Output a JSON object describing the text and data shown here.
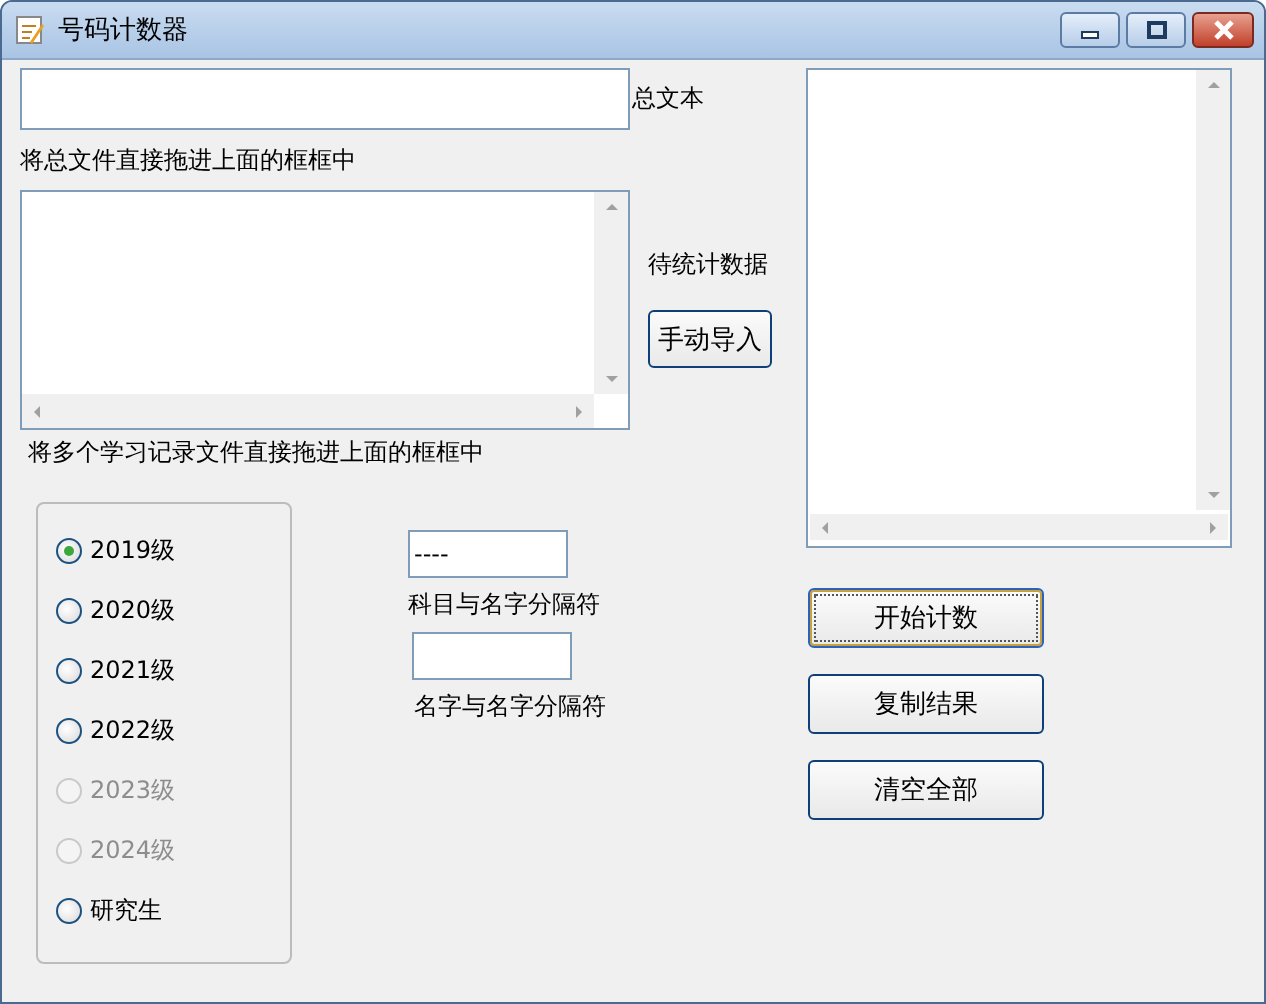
{
  "window": {
    "title": "号码计数器"
  },
  "total_text": {
    "label": "总文本",
    "hint": "将总文件直接拖进上面的框框中"
  },
  "records": {
    "label": "待统计数据",
    "button": "手动导入",
    "hint": "将多个学习记录文件直接拖进上面的框框中"
  },
  "grades": [
    {
      "label": "2019级",
      "selected": true,
      "disabled": false
    },
    {
      "label": "2020级",
      "selected": false,
      "disabled": false
    },
    {
      "label": "2021级",
      "selected": false,
      "disabled": false
    },
    {
      "label": "2022级",
      "selected": false,
      "disabled": false
    },
    {
      "label": "2023级",
      "selected": false,
      "disabled": true
    },
    {
      "label": "2024级",
      "selected": false,
      "disabled": true
    },
    {
      "label": "研究生",
      "selected": false,
      "disabled": false
    }
  ],
  "separators": [
    {
      "value": "----",
      "label": "科目与名字分隔符"
    },
    {
      "label": "名字与名字分隔符"
    }
  ],
  "buttons": [
    {
      "label": "开始计数",
      "focused": true
    },
    {
      "label": "复制结果",
      "focused": false
    },
    {
      "label": "清空全部",
      "focused": false
    }
  ]
}
